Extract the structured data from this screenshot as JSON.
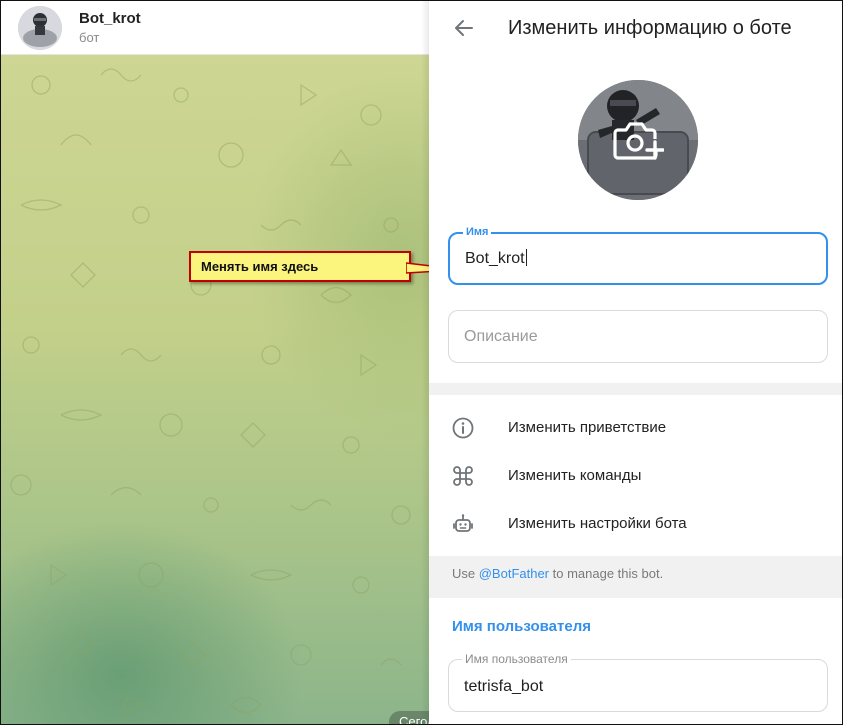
{
  "chat": {
    "title": "Bot_krot",
    "status": "бот",
    "date_pill": "Сегодня"
  },
  "callout": {
    "text": "Менять имя здесь"
  },
  "panel": {
    "title": "Изменить информацию о боте",
    "name_field": {
      "label": "Имя",
      "value": "Bot_krot"
    },
    "description_field": {
      "placeholder": "Описание"
    },
    "menu": [
      {
        "label": "Изменить приветствие",
        "icon": "info-icon"
      },
      {
        "label": "Изменить команды",
        "icon": "command-icon"
      },
      {
        "label": "Изменить настройки бота",
        "icon": "bot-icon"
      }
    ],
    "hint": {
      "prefix": "Use ",
      "link": "@BotFather",
      "suffix": " to manage this bot."
    },
    "username_section": {
      "title": "Имя пользователя",
      "label": "Имя пользователя",
      "value": "tetrisfa_bot"
    }
  },
  "colors": {
    "accent": "#3390ec",
    "callout_bg": "#fbf57e",
    "callout_border": "#c00000"
  }
}
